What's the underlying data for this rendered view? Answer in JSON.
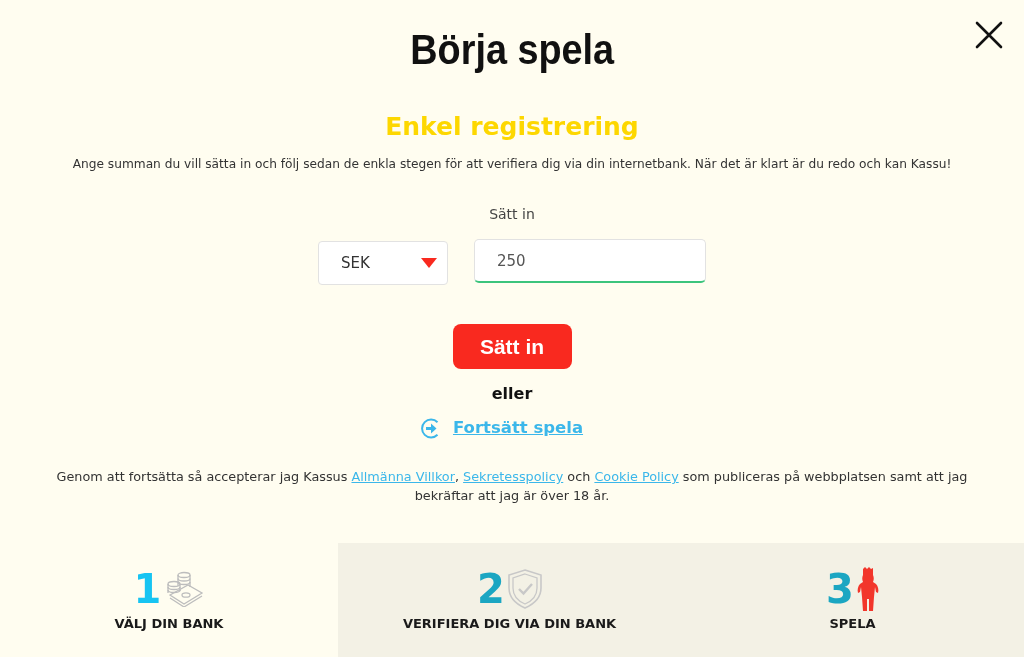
{
  "title": "Börja spela",
  "subtitle": "Enkel registrering",
  "description": "Ange summan du vill sätta in och följ sedan de enkla stegen för att verifiera dig via din internetbank. När det är klart är du redo och kan Kassu!",
  "deposit": {
    "label": "Sätt in",
    "currency": "SEK",
    "amount": {
      "value": "250",
      "focused": true
    },
    "button": "Sätt in"
  },
  "separator": "eller",
  "continue_link": "Fortsätt spela",
  "terms": [
    {
      "kind": "text",
      "text": "Genom att fortsätta så accepterar jag Kassus "
    },
    {
      "kind": "link",
      "text": "Allmänna Villkor"
    },
    {
      "kind": "text",
      "text": ", "
    },
    {
      "kind": "link",
      "text": "Sekretesspolicy"
    },
    {
      "kind": "text",
      "text": " och "
    },
    {
      "kind": "link",
      "text": "Cookie Policy"
    },
    {
      "kind": "text",
      "text": " som publiceras på webbplatsen samt att jag bekräftar att jag är över 18 år."
    }
  ],
  "steps": [
    {
      "number": "1",
      "label": "VÄLJ DIN BANK",
      "kind": "bank",
      "selected": true
    },
    {
      "number": "2",
      "label": "VERIFIERA DIG VIA DIN BANK",
      "kind": "verify",
      "selected": false
    },
    {
      "number": "3",
      "label": "SPELA",
      "kind": "play",
      "selected": false
    }
  ]
}
